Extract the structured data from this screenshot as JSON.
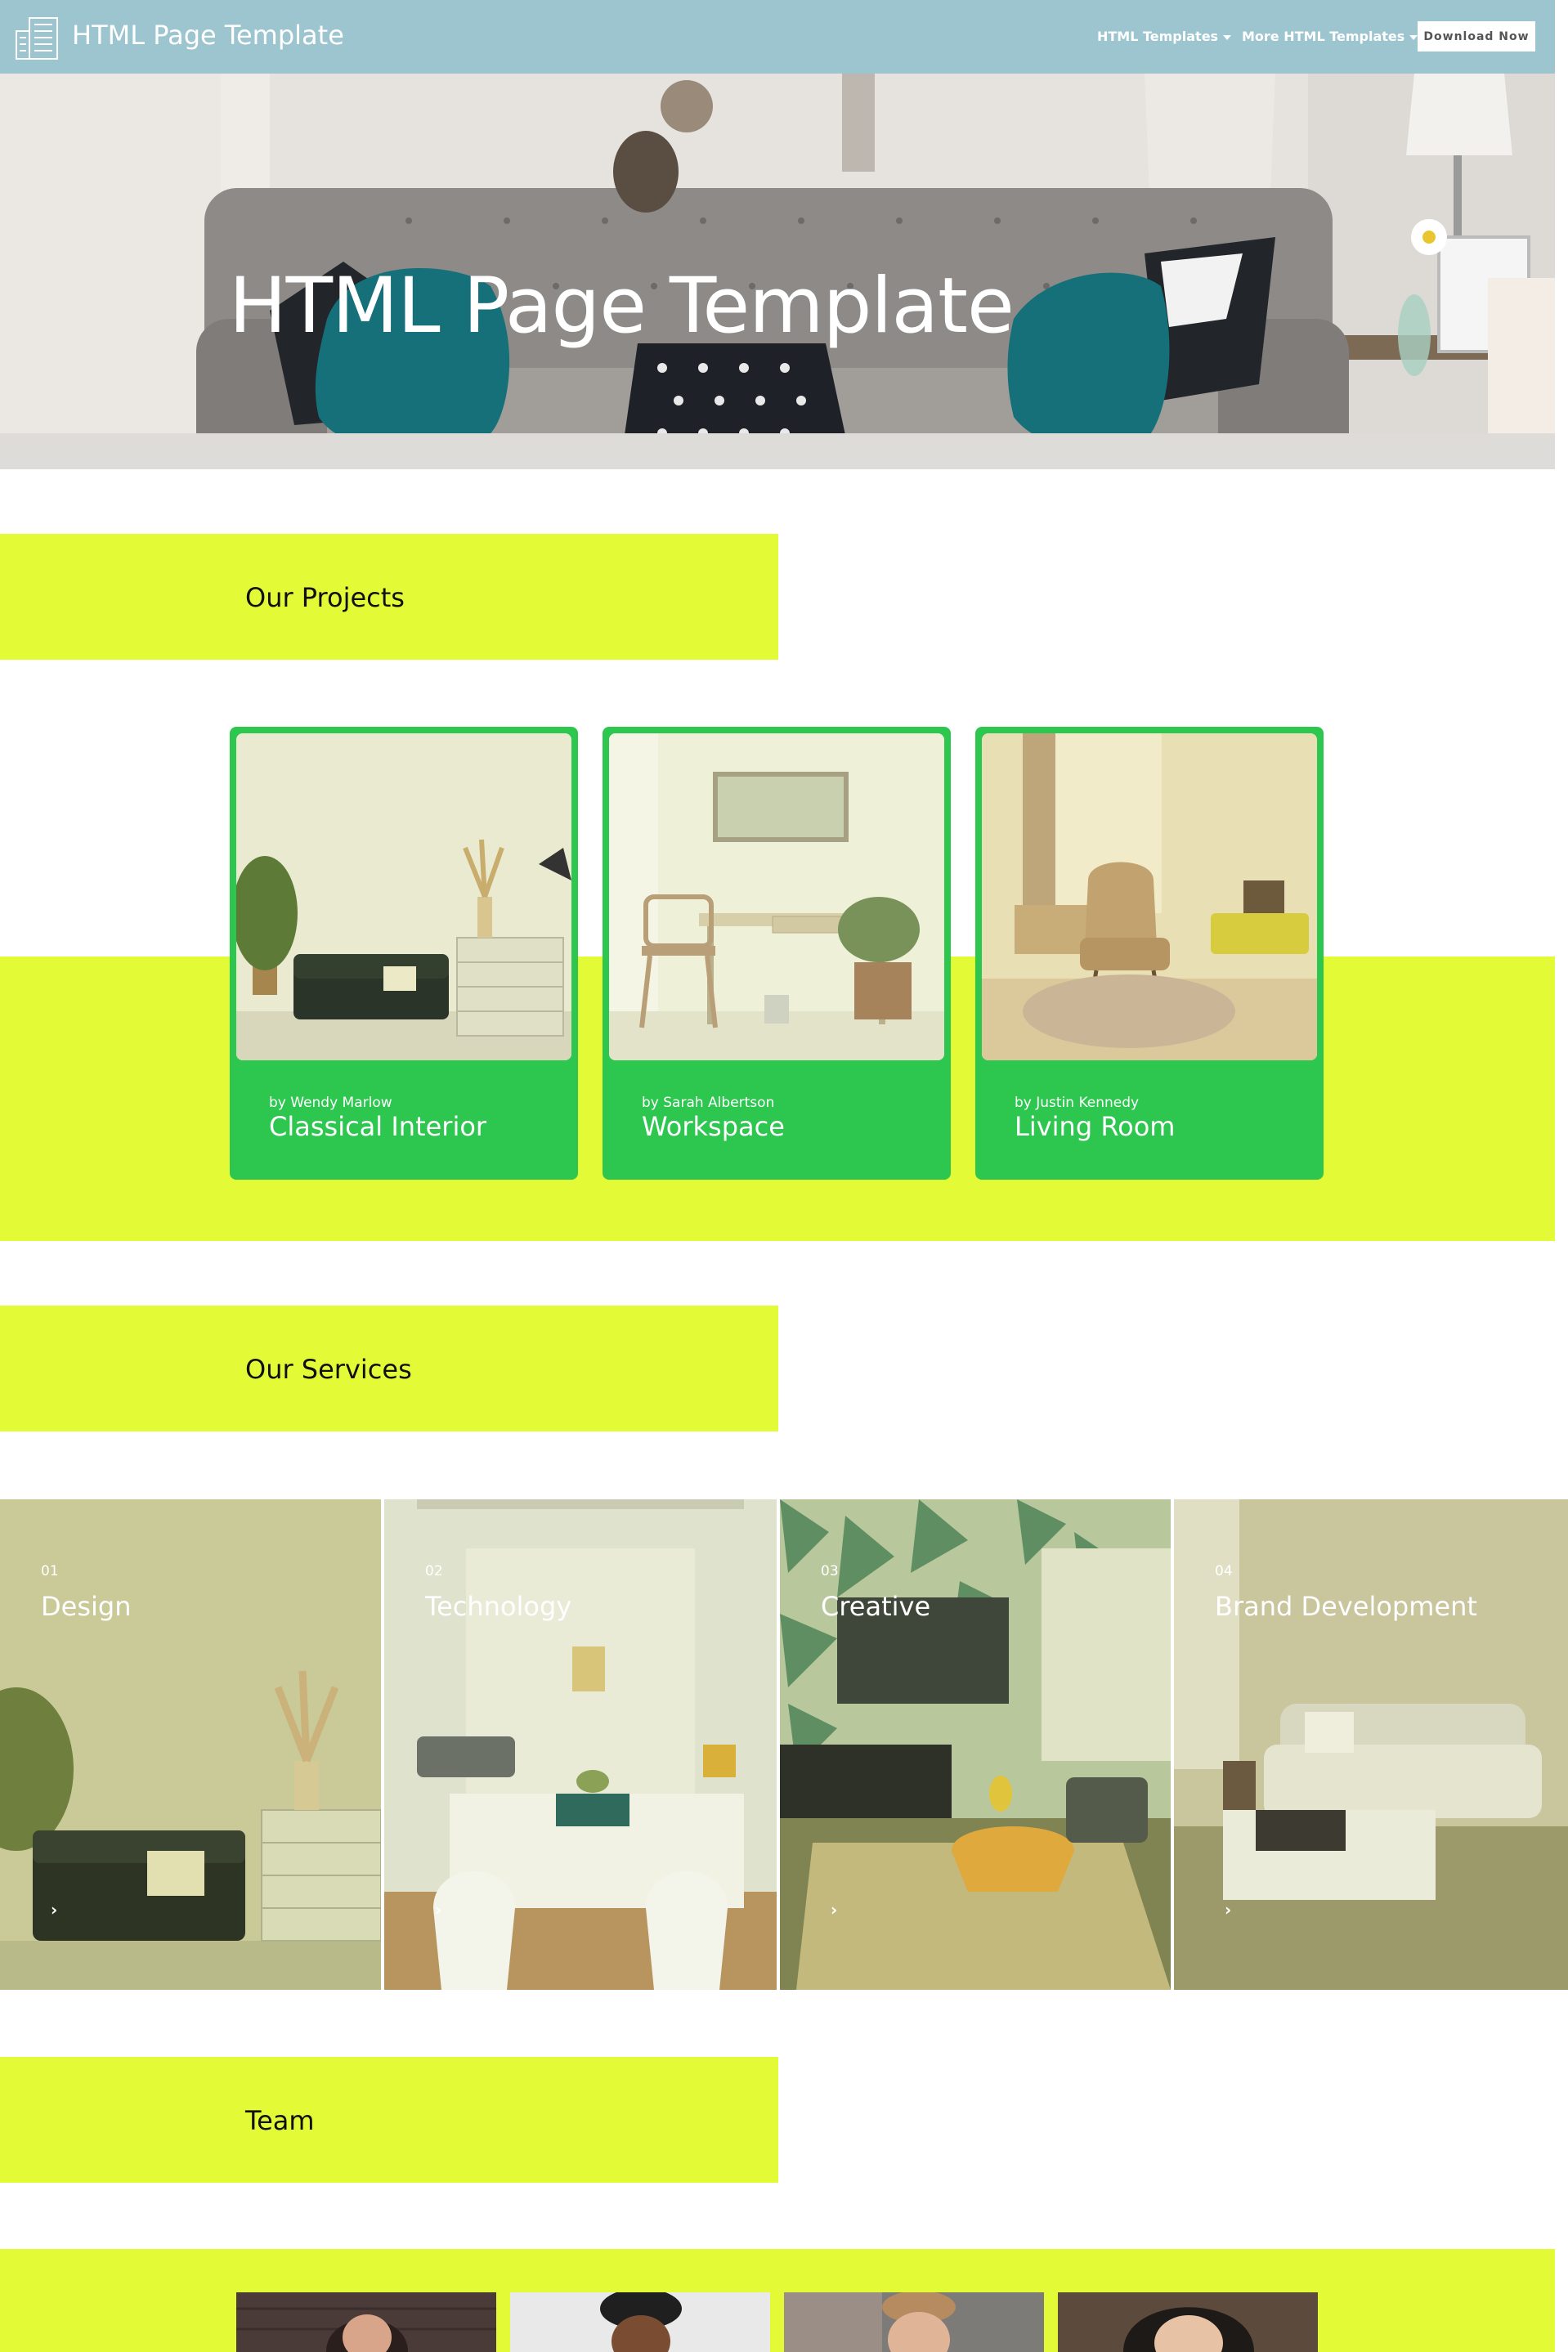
{
  "navbar": {
    "brand_title": "HTML Page Template",
    "brand_icon": "buildings-icon",
    "menu": [
      {
        "label": "HTML Templates",
        "icon": "chevron-down-icon"
      },
      {
        "label": "More HTML Templates",
        "icon": "chevron-down-icon"
      }
    ],
    "download_label": "Download Now",
    "bg_color": "#9cc5d0"
  },
  "hero": {
    "title": "HTML Page Template"
  },
  "projects": {
    "heading": "Our Projects",
    "cards": [
      {
        "author": "by Wendy Marlow",
        "title": "Classical Interior"
      },
      {
        "author": "by Sarah Albertson",
        "title": "Workspace"
      },
      {
        "author": "by Justin Kennedy",
        "title": "Living Room"
      }
    ],
    "accent_color": "#e3fa37",
    "card_color": "#2dc74f"
  },
  "services": {
    "heading": "Our Services",
    "items": [
      {
        "number": "01",
        "title": "Design",
        "arrow_icon": "chevron-right-icon"
      },
      {
        "number": "02",
        "title": "Technology",
        "arrow_icon": "chevron-right-icon"
      },
      {
        "number": "03",
        "title": "Creative",
        "arrow_icon": "chevron-right-icon"
      },
      {
        "number": "04",
        "title": "Brand Development",
        "arrow_icon": "chevron-right-icon"
      }
    ]
  },
  "team": {
    "heading": "Team"
  }
}
